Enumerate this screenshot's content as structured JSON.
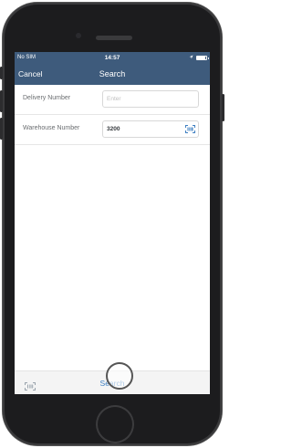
{
  "status_bar": {
    "carrier": "No SIM",
    "time": "14:57",
    "battery_level": 0.85
  },
  "nav": {
    "cancel_label": "Cancel",
    "title": "Search"
  },
  "form": {
    "fields": [
      {
        "label": "Delivery Number",
        "value": "",
        "placeholder": "Enter",
        "has_barcode": false
      },
      {
        "label": "Warehouse Number",
        "value": "3200",
        "placeholder": "",
        "has_barcode": true
      }
    ]
  },
  "footer": {
    "search_label": "Search"
  },
  "colors": {
    "header_bg": "#3e5b7c",
    "link": "#3e7fc1"
  },
  "icons": [
    "location-arrow-icon",
    "battery-icon",
    "barcode-icon",
    "barcode-scan-icon"
  ]
}
